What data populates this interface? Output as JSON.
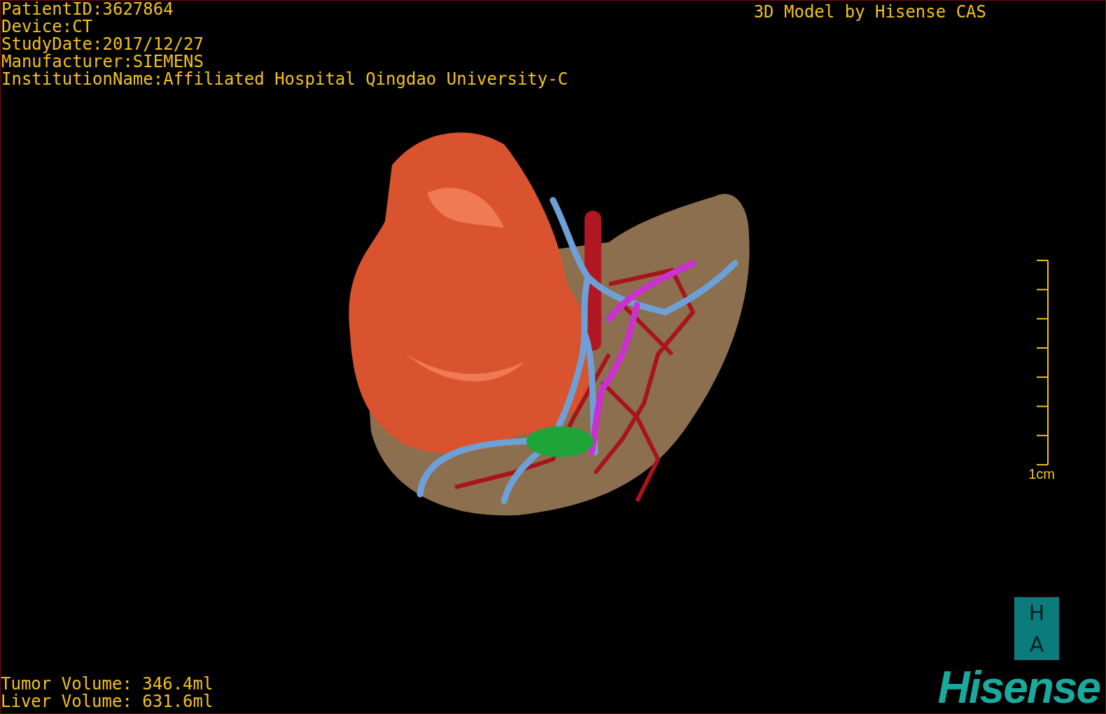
{
  "header": {
    "info_lines": [
      "PatientID:3627864",
      "Device:CT",
      "StudyDate:2017/12/27",
      "Manufacturer:SIEMENS",
      "InstitutionName:Affiliated Hospital Qingdao University-C"
    ],
    "caption": "3D Model by Hisense CAS"
  },
  "scale": {
    "label": "1cm"
  },
  "orientation": {
    "top": "H",
    "bottom": "A"
  },
  "volumes": [
    "Tumor Volume: 346.4ml",
    "Liver Volume: 631.6ml"
  ],
  "logo": "Hisense"
}
